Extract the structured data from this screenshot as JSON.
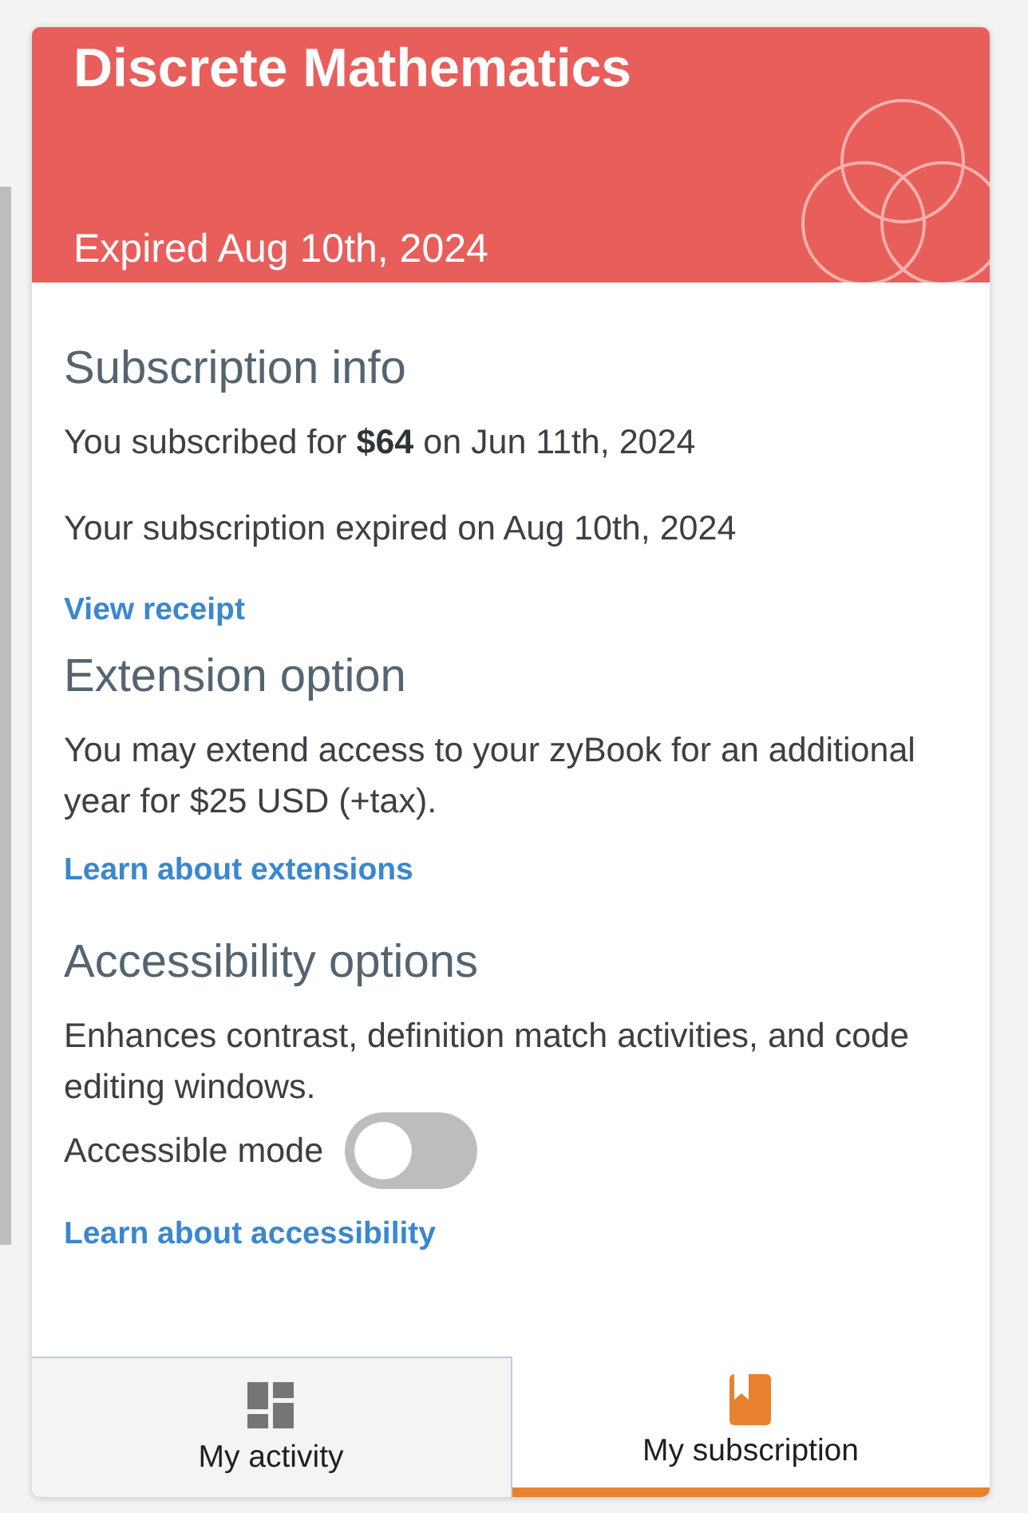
{
  "course": {
    "title": "Discrete Mathematics",
    "status": "Expired Aug 10th, 2024"
  },
  "sections": [
    {
      "heading": "Subscription info",
      "paragraphs": [
        "You subscribed for **$64** on Jun 11th, 2024",
        "Your subscription expired on Aug 10th, 2024"
      ],
      "link": "View receipt"
    },
    {
      "heading": "Extension option",
      "paragraphs": [
        "You may extend access to your zyBook for an additional year for $25 USD (+tax)."
      ],
      "link": "Learn about extensions"
    },
    {
      "heading": "Accessibility options",
      "paragraphs": [
        "Enhances contrast, definition match activities, and code editing windows."
      ],
      "toggle": {
        "label": "Accessible mode",
        "on": false
      },
      "link": "Learn about accessibility"
    }
  ],
  "tabs": [
    {
      "label": "My activity",
      "selected": false
    },
    {
      "label": "My subscription",
      "selected": true
    }
  ]
}
